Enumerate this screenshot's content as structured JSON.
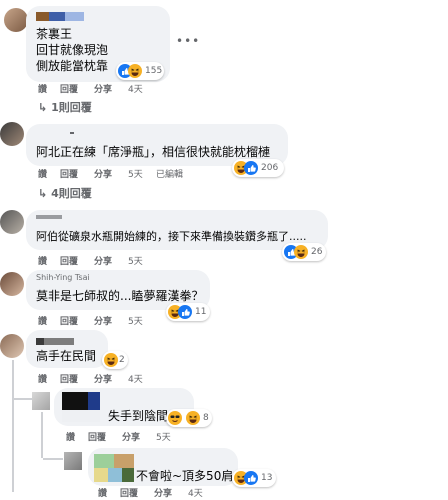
{
  "comments": [
    {
      "id": "c1",
      "author": "",
      "lines": [
        "茶裏王",
        "回甘就像現泡",
        "側放能當枕靠"
      ],
      "reaction_count": "155",
      "actions": {
        "like": "讚",
        "reply": "回覆",
        "share": "分享",
        "time": "4天"
      },
      "replies_link": "1則回覆"
    },
    {
      "id": "c2",
      "author": "",
      "lines": [
        "阿北正在練「席淨瓶」，相信很快就能枕榴槤"
      ],
      "reaction_count": "206",
      "actions": {
        "like": "讚",
        "reply": "回覆",
        "share": "分享",
        "time": "5天",
        "edited": "已編輯"
      },
      "replies_link": "4則回覆"
    },
    {
      "id": "c3",
      "author": "",
      "lines": [
        "阿伯從礦泉水瓶開始練的，接下來準備換裝鑽多瓶了....."
      ],
      "reaction_count": "26",
      "actions": {
        "like": "讚",
        "reply": "回覆",
        "share": "分享",
        "time": "5天"
      }
    },
    {
      "id": "c4",
      "author": "Shih-Ying Tsai",
      "lines": [
        "莫非是七師叔的...瞌夢羅漢拳？"
      ],
      "reaction_count": "11",
      "actions": {
        "like": "讚",
        "reply": "回覆",
        "share": "分享",
        "time": "5天"
      }
    },
    {
      "id": "c5",
      "author": "",
      "lines": [
        "高手在民間"
      ],
      "reaction_count": "2",
      "actions": {
        "like": "讚",
        "reply": "回覆",
        "share": "分享",
        "time": "4天"
      }
    },
    {
      "id": "r1",
      "author": "",
      "lines": [
        "失手到陰間"
      ],
      "reaction_count": "8",
      "actions": {
        "like": "讚",
        "reply": "回覆",
        "share": "分享",
        "time": "5天"
      }
    },
    {
      "id": "r2",
      "author": "",
      "lines": [
        "不會啦~頂多50肩"
      ],
      "reaction_count": "13",
      "actions": {
        "like": "讚",
        "reply": "回覆",
        "share": "分享",
        "time": "4天"
      }
    }
  ],
  "colors": {
    "bubble": "#f0f2f5",
    "meta_text": "#65676b",
    "like_blue": "#1877f2",
    "haha_yellow": "#f7b125",
    "thread_line": "#ced0d4"
  },
  "icons": {
    "more": "more-options-icon",
    "reply_arrow": "reply-arrow-icon",
    "like": "like-reaction-icon",
    "haha": "haha-reaction-icon",
    "cool": "sunglasses-emoji-icon"
  }
}
